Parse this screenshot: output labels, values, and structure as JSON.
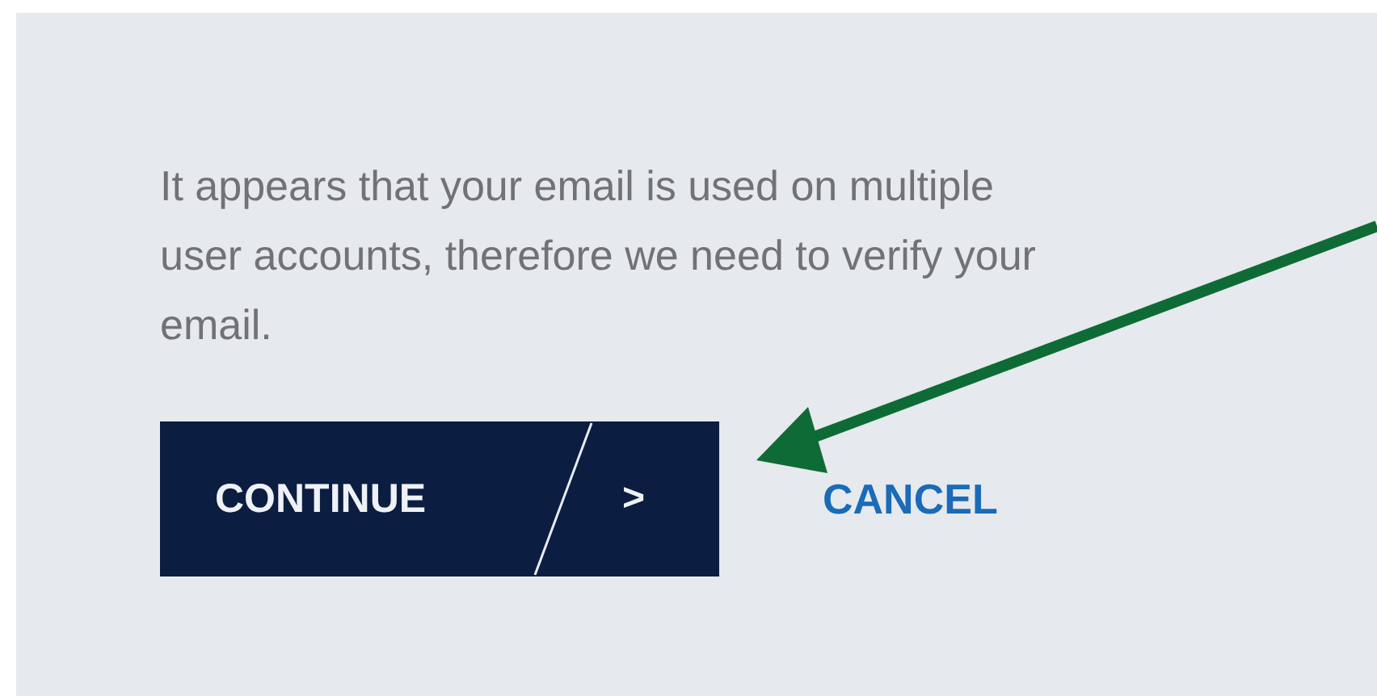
{
  "message": "It appears that your email is used on multiple user accounts, therefore we need to verify your email.",
  "continue_button": {
    "label": "CONTINUE",
    "chevron": ">"
  },
  "cancel_link": {
    "label": "CANCEL"
  }
}
